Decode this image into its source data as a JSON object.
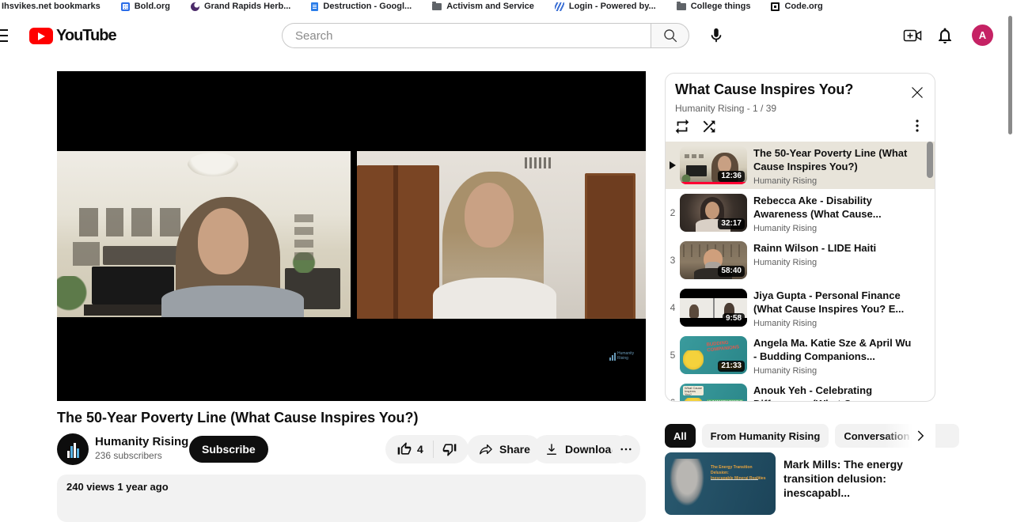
{
  "bookmarks_bar": {
    "items": [
      {
        "label": "Ihsvikes.net bookmarks",
        "icon": "none"
      },
      {
        "label": "Bold.org",
        "icon": "blue-grid-icon"
      },
      {
        "label": "Grand Rapids Herb...",
        "icon": "purple-circle-icon"
      },
      {
        "label": "Destruction - Googl...",
        "icon": "google-docs-icon"
      },
      {
        "label": "Activism and Service",
        "icon": "folder-icon"
      },
      {
        "label": "Login - Powered by...",
        "icon": "blue-stripes-icon"
      },
      {
        "label": "College things",
        "icon": "folder-icon"
      },
      {
        "label": "Code.org",
        "icon": "code-grid-icon"
      }
    ]
  },
  "header": {
    "logo_label": "YouTube",
    "search_placeholder": "Search",
    "avatar_letter": "A"
  },
  "video_page": {
    "title": "The 50-Year Poverty Line (What Cause Inspires You?)",
    "channel_name": "Humanity Rising",
    "subscriber_count": "236 subscribers",
    "subscribe_label": "Subscribe",
    "like_count": "4",
    "share_label": "Share",
    "download_label": "Download",
    "description_preview": "240 views  1 year ago",
    "watermark": "Humanity Rising"
  },
  "playlist": {
    "title": "What Cause Inspires You?",
    "subtitle": "Humanity Rising - 1 / 39",
    "items": [
      {
        "duration": "12:36",
        "title": "The 50-Year Poverty Line (What Cause Inspires You?)",
        "channel": "Humanity Rising",
        "now_playing": true
      },
      {
        "index": "2",
        "duration": "32:17",
        "title": "Rebecca Ake - Disability Awareness (What Cause...",
        "channel": "Humanity Rising"
      },
      {
        "index": "3",
        "duration": "58:40",
        "title": "Rainn Wilson - LIDE Haiti",
        "channel": "Humanity Rising"
      },
      {
        "index": "4",
        "duration": "9:58",
        "title": "Jiya Gupta - Personal Finance (What Cause Inspires You? E...",
        "channel": "Humanity Rising"
      },
      {
        "index": "5",
        "duration": "21:33",
        "title": "Angela Ma. Katie Sze & April Wu - Budding Companions...",
        "channel": "Humanity Rising"
      },
      {
        "index": "6",
        "title": "Anouk Yeh - Celebrating Differences (What Cause"
      }
    ]
  },
  "related": {
    "chips": [
      {
        "label": "All",
        "selected": true
      },
      {
        "label": "From Humanity Rising"
      },
      {
        "label": "Conversation"
      }
    ],
    "videos": [
      {
        "title": "Mark Mills: The energy transition delusion: inescapabl...",
        "thumb_caption_line1": "The Energy Transition Delusion:",
        "thumb_caption_line2": "Inescapable Mineral Realities"
      }
    ]
  }
}
